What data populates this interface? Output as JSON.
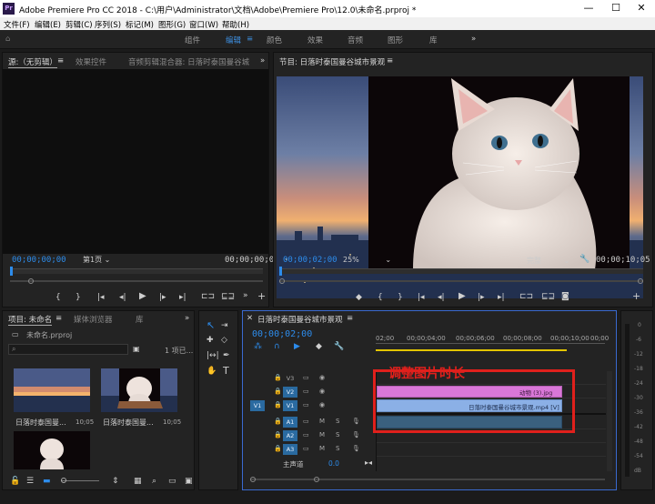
{
  "titlebar": {
    "icon": "Pr",
    "title": "Adobe Premiere Pro CC 2018 - C:\\用户\\Administrator\\文档\\Adobe\\Premiere Pro\\12.0\\未命名.prproj *",
    "minimize": "—",
    "maximize": "☐",
    "close": "✕"
  },
  "menu": [
    "文件(F)",
    "编辑(E)",
    "剪辑(C)",
    "序列(S)",
    "标记(M)",
    "图形(G)",
    "窗口(W)",
    "帮助(H)"
  ],
  "workspaces": {
    "items": [
      "组件",
      "编辑",
      "颜色",
      "效果",
      "音频",
      "图形",
      "库"
    ],
    "active": "编辑",
    "more": "»"
  },
  "source": {
    "tab1": "源:（无剪辑）",
    "tab2": "效果控件",
    "tab3": "音频剪辑混合器: 日落时泰国曼谷城",
    "timecode_left": "00;00;00;00",
    "page": "第1页",
    "timecode_right": "00;00;00;00"
  },
  "program": {
    "tab": "节目: 日落时泰国曼谷城市景观",
    "timecode_left": "00;00;02;00",
    "zoom": "25%",
    "quality": "完整",
    "timecode_right": "00;00;10;05"
  },
  "project": {
    "tab1": "项目: 未命名",
    "tab2": "媒体浏览器",
    "tab3": "库",
    "file": "未命名.prproj",
    "count": "1 项已...",
    "items": [
      {
        "name": "日落时泰国曼...",
        "dur": "10;05"
      },
      {
        "name": "日落时泰国曼...",
        "dur": "10;05"
      }
    ]
  },
  "timeline": {
    "tab": "日落时泰国曼谷城市景观",
    "timecode": "00;00;02;00",
    "ruler": [
      "02;00",
      "00;00;04;00",
      "00;00;06;00",
      "00;00;08;00",
      "00;00;10;00",
      "00;00"
    ],
    "tracks_v": [
      "V3",
      "V2",
      "V1"
    ],
    "tracks_a": [
      "A1",
      "A2",
      "A3"
    ],
    "master": "主声道",
    "master_val": "0.0",
    "source_v": "V1",
    "clip_v2": "动物 (3).jpg",
    "clip_v1": "日落时泰国曼谷城市景观.mp4 [V]",
    "annotation": "调整图片时长",
    "annotation_color": "#e0201c"
  },
  "meter": {
    "labels": [
      "0",
      "-6",
      "-12",
      "-18",
      "-24",
      "-30",
      "-36",
      "-42",
      "-48",
      "-54",
      "dB"
    ]
  },
  "colors": {
    "accent": "#2d8ceb",
    "clip_v2": "#d977d8",
    "clip_v1": "#8bb0e6",
    "audio_clip": "#3a607e"
  }
}
